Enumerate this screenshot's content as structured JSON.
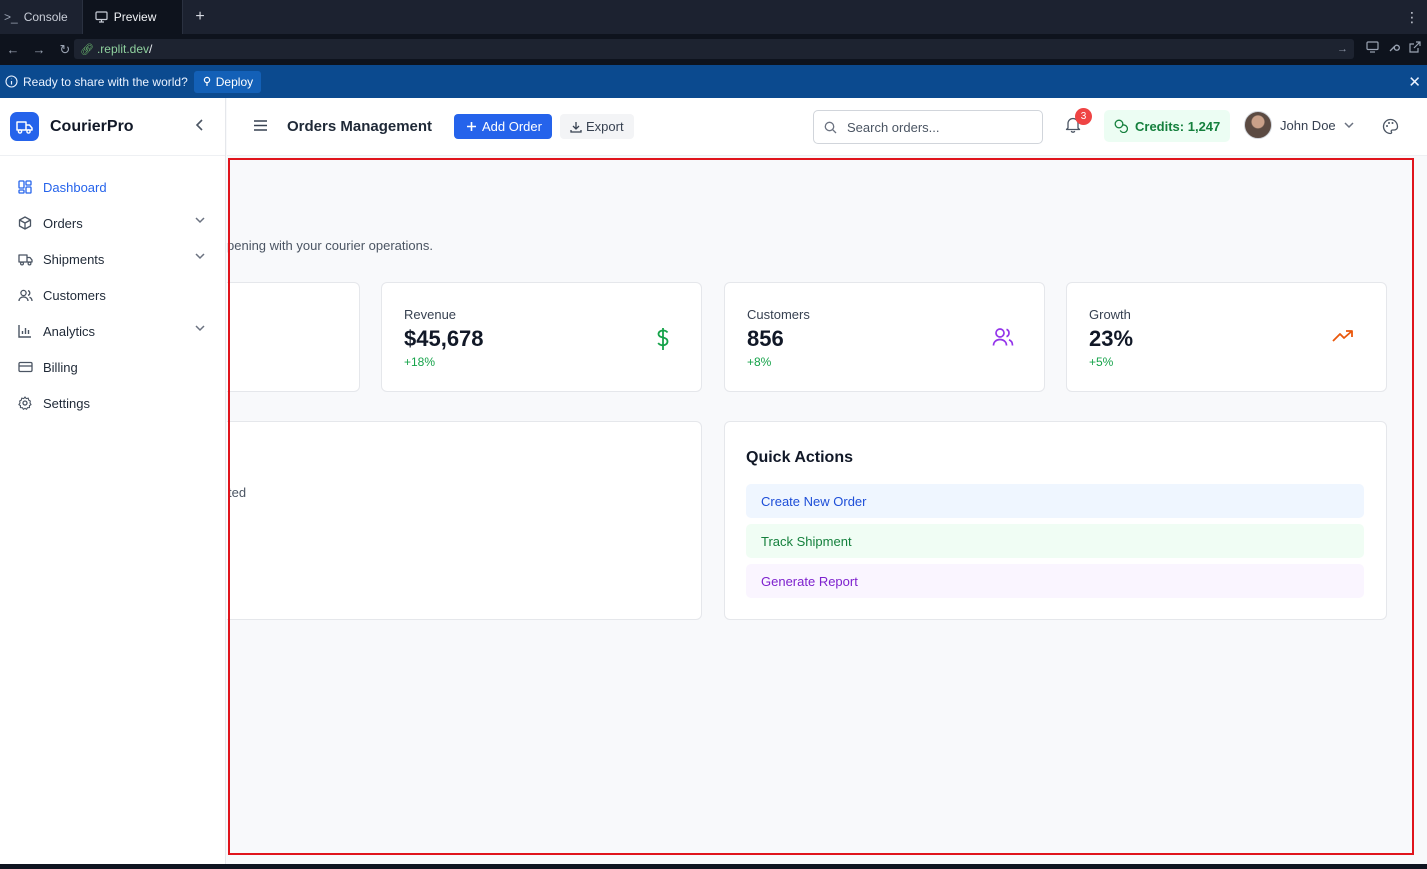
{
  "browser": {
    "tabs": [
      {
        "label": "Console",
        "glyph": ">_"
      },
      {
        "label": "Preview",
        "glyph": "preview-icon"
      }
    ],
    "new_tab": "+",
    "url_domain": ".replit.dev",
    "url_path": "/"
  },
  "banner": {
    "message": "Ready to share with the world?",
    "deploy_label": "Deploy"
  },
  "sidebar": {
    "brand": "CourierPro",
    "items": [
      {
        "label": "Dashboard",
        "icon": "dashboard-icon",
        "active": true
      },
      {
        "label": "Orders",
        "icon": "package-icon",
        "expandable": true
      },
      {
        "label": "Shipments",
        "icon": "truck-icon",
        "expandable": true
      },
      {
        "label": "Customers",
        "icon": "users-icon"
      },
      {
        "label": "Analytics",
        "icon": "bar-chart-icon",
        "expandable": true
      },
      {
        "label": "Billing",
        "icon": "credit-card-icon"
      },
      {
        "label": "Settings",
        "icon": "gear-icon"
      }
    ]
  },
  "topbar": {
    "title": "Orders Management",
    "add_order": "Add Order",
    "export": "Export",
    "search_placeholder": "Search orders...",
    "notifications": "3",
    "credits": "Credits: 1,247",
    "user_name": "John Doe"
  },
  "content": {
    "subtitle_fragment": "pening with your courier operations.",
    "stats": [
      {
        "label": "Revenue",
        "value": "$45,678",
        "change": "+18%",
        "icon": "dollar-icon",
        "color": "#16a34a"
      },
      {
        "label": "Customers",
        "value": "856",
        "change": "+8%",
        "icon": "users-icon",
        "color": "#9333ea"
      },
      {
        "label": "Growth",
        "value": "23%",
        "change": "+5%",
        "icon": "trending-up-icon",
        "color": "#ea580c"
      }
    ],
    "activity_fragment": "ted",
    "quick_actions": {
      "title": "Quick Actions",
      "items": [
        "Create New Order",
        "Track Shipment",
        "Generate Report"
      ]
    }
  },
  "colors": {
    "accent": "#2563eb",
    "highlight": "#e0141c"
  }
}
